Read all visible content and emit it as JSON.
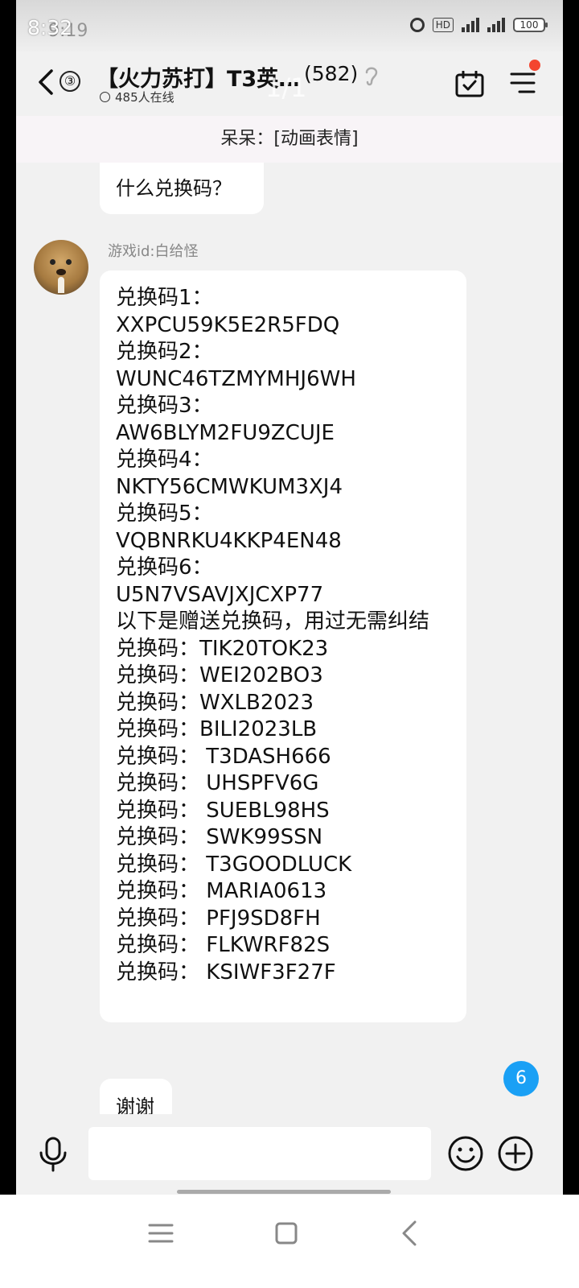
{
  "status_bar": {
    "time": "8:32",
    "time_ghost": "9:19",
    "hd_label": "HD",
    "battery": "100"
  },
  "header": {
    "unread_count": "③",
    "group_title": "【火力苏打】T3英…",
    "member_count": "(582)",
    "online_text": "485人在线",
    "page_indicator": "1/1"
  },
  "pinned": {
    "text": "呆呆：[动画表情]"
  },
  "messages": [
    {
      "text": "什么兑换码？"
    },
    {
      "sender": "游戏id:白给怪",
      "lines": [
        "兑换码1：",
        "XXPCU59K5E2R5FDQ",
        "兑换码2：",
        "WUNC46TZMYMHJ6WH",
        "兑换码3：",
        "AW6BLYM2FU9ZCUJE",
        "兑换码4：",
        "NKTY56CMWKUM3XJ4",
        "兑换码5：",
        "VQBNRKU4KKP4EN48",
        "兑换码6：",
        "U5N7VSAVJXJCXP77",
        "以下是赠送兑换码，用过无需纠结",
        "兑换码：TIK20TOK23",
        "兑换码：WEI202BO3",
        "兑换码：WXLB2023",
        "兑换码：BILI2023LB",
        "兑换码： T3DASH666",
        "兑换码： UHSPFV6G",
        "兑换码： SUEBL98HS",
        "兑换码： SWK99SSN",
        "兑换码： T3GOODLUCK",
        "兑换码： MARIA0613",
        "兑换码： PFJ9SD8FH",
        "兑换码： FLKWRF82S",
        "兑换码： KSIWF3F27F"
      ]
    },
    {
      "text": "谢谢"
    }
  ],
  "floating_unread": "6",
  "input": {
    "placeholder": ""
  },
  "icons": {
    "back": "back-icon",
    "ear": "ear-icon",
    "calendar": "calendar-check-icon",
    "menu": "menu-icon",
    "mic": "mic-icon",
    "emoji": "emoji-icon",
    "plus": "plus-icon"
  },
  "colors": {
    "accent_blue": "#1aa0f5",
    "notification_red": "#f4452f"
  }
}
